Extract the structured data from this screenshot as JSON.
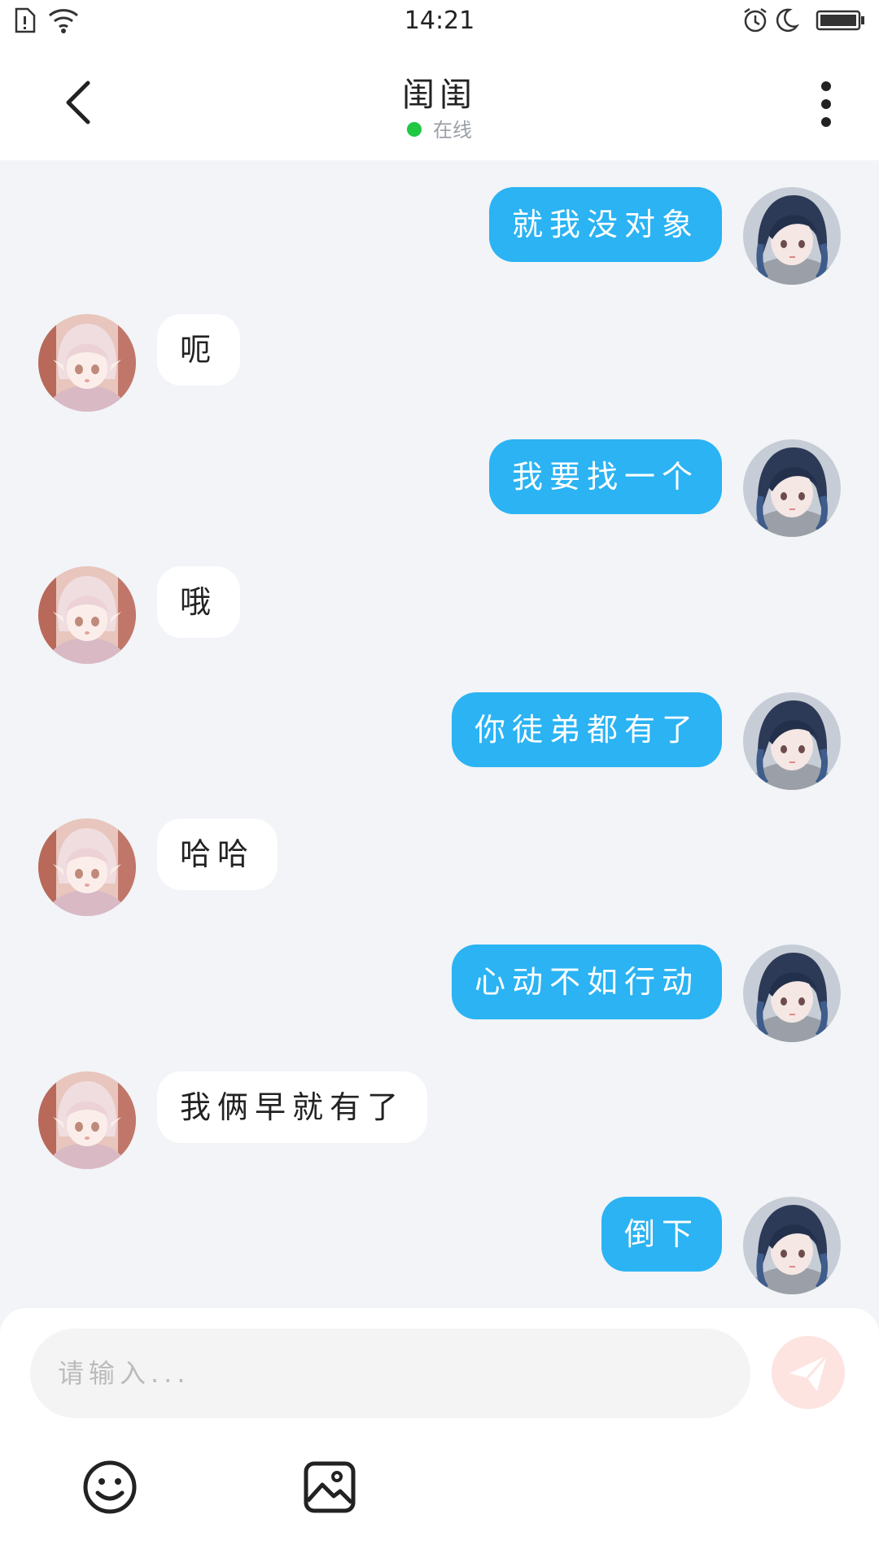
{
  "status_bar": {
    "time": "14:21"
  },
  "header": {
    "title": "闺闺",
    "status": "在线"
  },
  "messages": [
    {
      "side": "right",
      "text": "就我没对象"
    },
    {
      "side": "left",
      "text": "呃"
    },
    {
      "side": "right",
      "text": "我要找一个"
    },
    {
      "side": "left",
      "text": "哦"
    },
    {
      "side": "right",
      "text": "你徒弟都有了"
    },
    {
      "side": "left",
      "text": "哈哈"
    },
    {
      "side": "right",
      "text": "心动不如行动"
    },
    {
      "side": "left",
      "text": "我俩早就有了"
    },
    {
      "side": "right",
      "text": "倒下"
    }
  ],
  "composer": {
    "placeholder": "请输入..."
  },
  "colors": {
    "accent": "#2bb3f3",
    "online": "#1fc743",
    "send": "#fde4e1",
    "background": "#f2f4f7"
  },
  "icons": {
    "back": "chevron-left-icon",
    "more": "more-vertical-icon",
    "send": "paper-plane-icon",
    "emoji": "smiley-icon",
    "image": "image-icon"
  }
}
